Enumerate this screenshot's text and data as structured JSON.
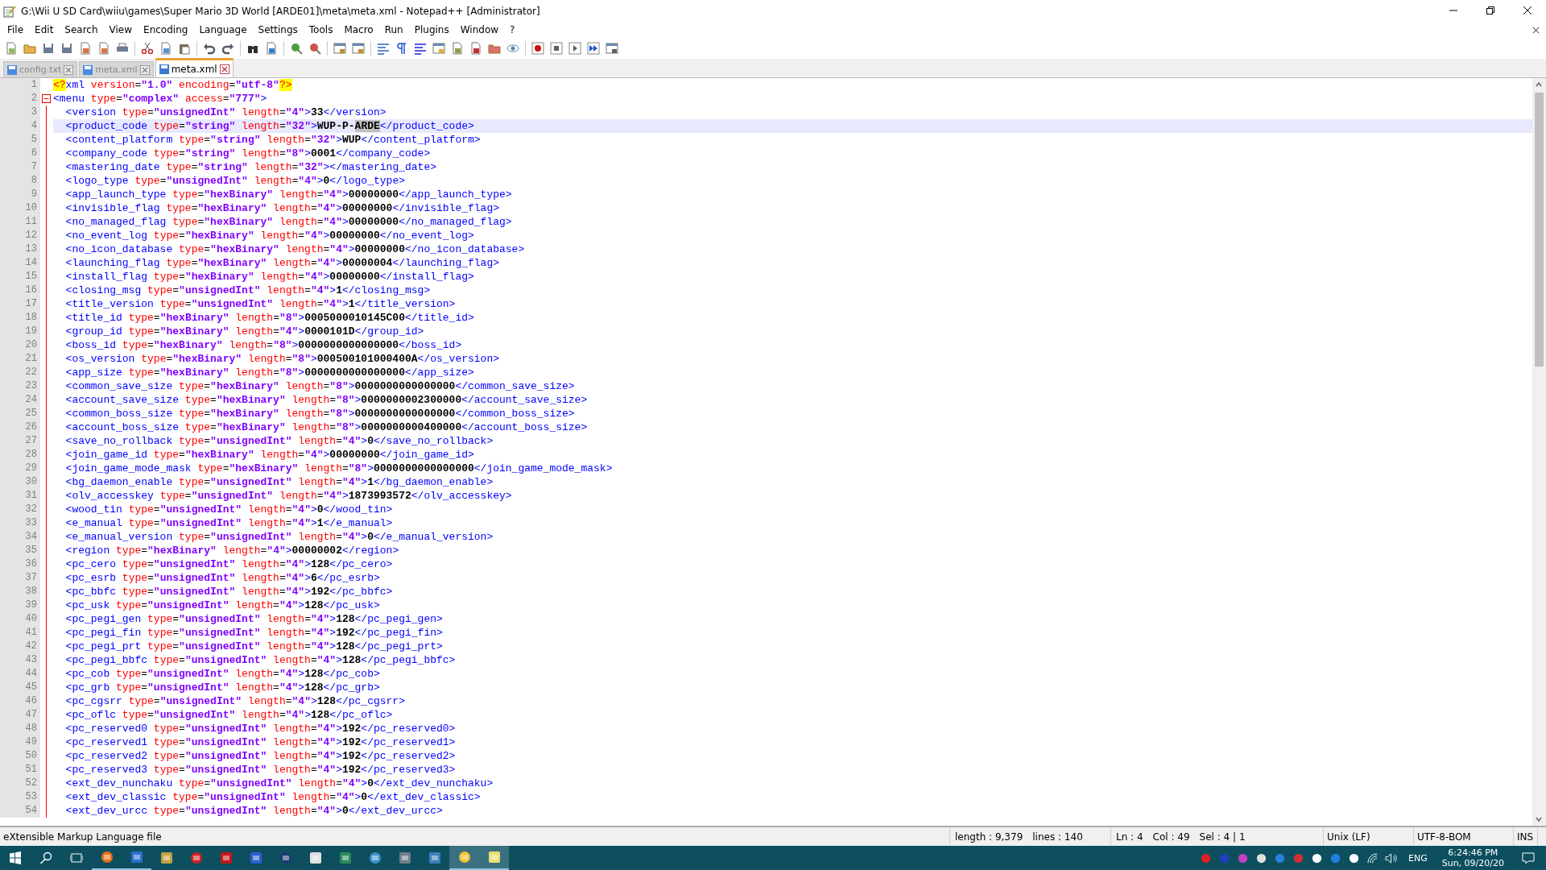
{
  "window": {
    "title": "G:\\Wii U SD Card\\wiiu\\games\\Super Mario 3D World [ARDE01]\\meta\\meta.xml - Notepad++ [Administrator]"
  },
  "menu": [
    "File",
    "Edit",
    "Search",
    "View",
    "Encoding",
    "Language",
    "Settings",
    "Tools",
    "Macro",
    "Run",
    "Plugins",
    "Window",
    "?"
  ],
  "tabs": [
    {
      "label": "config.txt",
      "selected": false
    },
    {
      "label": "meta.xml",
      "selected": false
    },
    {
      "label": "meta.xml",
      "selected": true
    }
  ],
  "editor": {
    "lines": [
      {
        "number": "1",
        "current": false,
        "code": "<?xml version=\"1.0\" encoding=\"utf-8\"?>"
      },
      {
        "number": "2",
        "current": false,
        "expanded": true,
        "code": "<menu type=\"complex\" access=\"777\">",
        "children": [
          {
            "number": "3",
            "current": false,
            "code": "<version type=\"unsignedInt\" length=\"4\">33</version>"
          },
          {
            "number": "4",
            "current": true,
            "code": "<product_code type=\"string\" length=\"32\">WUP-P-",
            "selection": "ARDE",
            "code_after": "</product_code>"
          },
          {
            "number": "5",
            "current": false,
            "code": "<content_platform type=\"string\" length=\"32\">WUP</content_platform>"
          },
          {
            "number": "6",
            "current": false,
            "code": "<company_code type=\"string\" length=\"8\">0001</company_code>"
          },
          {
            "number": "7",
            "current": false,
            "code": "<mastering_date type=\"string\" length=\"32\"></mastering_date>"
          },
          {
            "number": "8",
            "current": false,
            "code": "<logo_type type=\"unsignedInt\" length=\"4\">0</logo_type>"
          },
          {
            "number": "9",
            "current": false,
            "code": "<app_launch_type type=\"hexBinary\" length=\"4\">00000000</app_launch_type>"
          },
          {
            "number": "10",
            "current": false,
            "code": "<invisible_flag type=\"hexBinary\" length=\"4\">00000000</invisible_flag>"
          },
          {
            "number": "11",
            "current": false,
            "code": "<no_managed_flag type=\"hexBinary\" length=\"4\">00000000</no_managed_flag>"
          },
          {
            "number": "12",
            "current": false,
            "code": "<no_event_log type=\"hexBinary\" length=\"4\">00000000</no_event_log>"
          },
          {
            "number": "13",
            "current": false,
            "code": "<no_icon_database type=\"hexBinary\" length=\"4\">00000000</no_icon_database>"
          },
          {
            "number": "14",
            "current": false,
            "code": "<launching_flag type=\"hexBinary\" length=\"4\">00000004</launching_flag>"
          },
          {
            "number": "15",
            "current": false,
            "code": "<install_flag type=\"hexBinary\" length=\"4\">00000000</install_flag>"
          },
          {
            "number": "16",
            "current": false,
            "code": "<closing_msg type=\"unsignedInt\" length=\"4\">1</closing_msg>"
          },
          {
            "number": "17",
            "current": false,
            "code": "<title_version type=\"unsignedInt\" length=\"4\">1</title_version>"
          },
          {
            "number": "18",
            "current": false,
            "code": "<title_id type=\"hexBinary\" length=\"8\">0005000010145C00</title_id>"
          },
          {
            "number": "19",
            "current": false,
            "code": "<group_id type=\"hexBinary\" length=\"4\">0000101D</group_id>"
          },
          {
            "number": "20",
            "current": false,
            "code": "<boss_id type=\"hexBinary\" length=\"8\">0000000000000000</boss_id>"
          },
          {
            "number": "21",
            "current": false,
            "code": "<os_version type=\"hexBinary\" length=\"8\">000500101000400A</os_version>"
          },
          {
            "number": "22",
            "current": false,
            "code": "<app_size type=\"hexBinary\" length=\"8\">0000000000000000</app_size>"
          },
          {
            "number": "23",
            "current": false,
            "code": "<common_save_size type=\"hexBinary\" length=\"8\">0000000000000000</common_save_size>"
          },
          {
            "number": "24",
            "current": false,
            "code": "<account_save_size type=\"hexBinary\" length=\"8\">0000000002300000</account_save_size>"
          },
          {
            "number": "25",
            "current": false,
            "code": "<common_boss_size type=\"hexBinary\" length=\"8\">0000000000000000</common_boss_size>"
          },
          {
            "number": "26",
            "current": false,
            "code": "<account_boss_size type=\"hexBinary\" length=\"8\">0000000000400000</account_boss_size>"
          },
          {
            "number": "27",
            "current": false,
            "code": "<save_no_rollback type=\"unsignedInt\" length=\"4\">0</save_no_rollback>"
          },
          {
            "number": "28",
            "current": false,
            "code": "<join_game_id type=\"hexBinary\" length=\"4\">00000000</join_game_id>"
          },
          {
            "number": "29",
            "current": false,
            "code": "<join_game_mode_mask type=\"hexBinary\" length=\"8\">0000000000000000</join_game_mode_mask>"
          },
          {
            "number": "30",
            "current": false,
            "code": "<bg_daemon_enable type=\"unsignedInt\" length=\"4\">1</bg_daemon_enable>"
          },
          {
            "number": "31",
            "current": false,
            "code": "<olv_accesskey type=\"unsignedInt\" length=\"4\">1873993572</olv_accesskey>"
          },
          {
            "number": "32",
            "current": false,
            "code": "<wood_tin type=\"unsignedInt\" length=\"4\">0</wood_tin>"
          },
          {
            "number": "33",
            "current": false,
            "code": "<e_manual type=\"unsignedInt\" length=\"4\">1</e_manual>"
          },
          {
            "number": "34",
            "current": false,
            "code": "<e_manual_version type=\"unsignedInt\" length=\"4\">0</e_manual_version>"
          },
          {
            "number": "35",
            "current": false,
            "code": "<region type=\"hexBinary\" length=\"4\">00000002</region>"
          },
          {
            "number": "36",
            "current": false,
            "code": "<pc_cero type=\"unsignedInt\" length=\"4\">128</pc_cero>"
          },
          {
            "number": "37",
            "current": false,
            "code": "<pc_esrb type=\"unsignedInt\" length=\"4\">6</pc_esrb>"
          },
          {
            "number": "38",
            "current": false,
            "code": "<pc_bbfc type=\"unsignedInt\" length=\"4\">192</pc_bbfc>"
          },
          {
            "number": "39",
            "current": false,
            "code": "<pc_usk type=\"unsignedInt\" length=\"4\">128</pc_usk>"
          },
          {
            "number": "40",
            "current": false,
            "code": "<pc_pegi_gen type=\"unsignedInt\" length=\"4\">128</pc_pegi_gen>"
          },
          {
            "number": "41",
            "current": false,
            "code": "<pc_pegi_fin type=\"unsignedInt\" length=\"4\">192</pc_pegi_fin>"
          },
          {
            "number": "42",
            "current": false,
            "code": "<pc_pegi_prt type=\"unsignedInt\" length=\"4\">128</pc_pegi_prt>"
          },
          {
            "number": "43",
            "current": false,
            "code": "<pc_pegi_bbfc type=\"unsignedInt\" length=\"4\">128</pc_pegi_bbfc>"
          },
          {
            "number": "44",
            "current": false,
            "code": "<pc_cob type=\"unsignedInt\" length=\"4\">128</pc_cob>"
          },
          {
            "number": "45",
            "current": false,
            "code": "<pc_grb type=\"unsignedInt\" length=\"4\">128</pc_grb>"
          },
          {
            "number": "46",
            "current": false,
            "code": "<pc_cgsrr type=\"unsignedInt\" length=\"4\">128</pc_cgsrr>"
          },
          {
            "number": "47",
            "current": false,
            "code": "<pc_oflc type=\"unsignedInt\" length=\"4\">128</pc_oflc>"
          },
          {
            "number": "48",
            "current": false,
            "code": "<pc_reserved0 type=\"unsignedInt\" length=\"4\">192</pc_reserved0>"
          },
          {
            "number": "49",
            "current": false,
            "code": "<pc_reserved1 type=\"unsignedInt\" length=\"4\">192</pc_reserved1>"
          },
          {
            "number": "50",
            "current": false,
            "code": "<pc_reserved2 type=\"unsignedInt\" length=\"4\">192</pc_reserved2>"
          },
          {
            "number": "51",
            "current": false,
            "code": "<pc_reserved3 type=\"unsignedInt\" length=\"4\">192</pc_reserved3>"
          },
          {
            "number": "52",
            "current": false,
            "code": "<ext_dev_nunchaku type=\"unsignedInt\" length=\"4\">0</ext_dev_nunchaku>"
          },
          {
            "number": "53",
            "current": false,
            "code": "<ext_dev_classic type=\"unsignedInt\" length=\"4\">0</ext_dev_classic>"
          },
          {
            "number": "54",
            "current": false,
            "code": "<ext_dev_urcc type=\"unsignedInt\" length=\"4\">0</ext_dev_urcc>"
          }
        ]
      }
    ]
  },
  "status_bar": {
    "file_type": "eXtensible Markup Language file",
    "length": "length : 9,379",
    "lines": "lines : 140",
    "line": "Ln : 4",
    "column": "Col : 49",
    "selection": "Sel : 4 | 1",
    "eol": "Unix (LF)",
    "encoding": "UTF-8-BOM",
    "mode": "INS"
  },
  "taskbar": {
    "language": "ENG",
    "time": "6:24:46 PM",
    "date": "Sun, 09/20/20"
  }
}
